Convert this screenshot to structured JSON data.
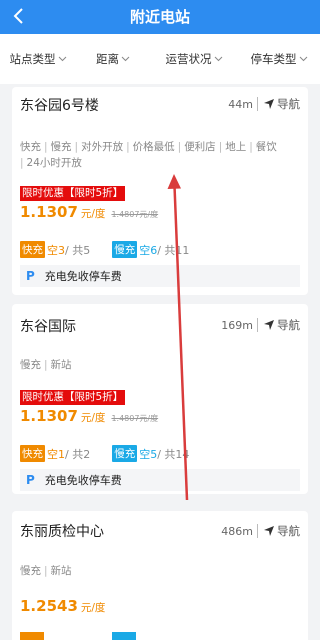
{
  "header": {
    "title": "附近电站"
  },
  "filters": [
    {
      "label": "站点类型"
    },
    {
      "label": "距离"
    },
    {
      "label": "运营状况"
    },
    {
      "label": "停车类型"
    }
  ],
  "stations": [
    {
      "name": "东谷园6号楼",
      "distance": "44m",
      "nav_label": "导航",
      "tags": [
        "快充",
        "慢充",
        "对外开放",
        "价格最低",
        "便利店",
        "地上",
        "餐饮",
        "24小时开放"
      ],
      "promo": "限时优惠【限时5折】",
      "price": "1.1307",
      "unit": "元/度",
      "original_price": "1.4807元/度",
      "fast": {
        "label": "快充",
        "free": "空3",
        "total": "/ 共5"
      },
      "slow": {
        "label": "慢充",
        "free": "空6",
        "total": "/ 共11"
      },
      "parking": {
        "icon": "P",
        "text": "充电免收停车费"
      }
    },
    {
      "name": "东谷国际",
      "distance": "169m",
      "nav_label": "导航",
      "tags": [
        "慢充",
        "新站"
      ],
      "promo": "限时优惠【限时5折】",
      "price": "1.1307",
      "unit": "元/度",
      "original_price": "1.4807元/度",
      "fast": {
        "label": "快充",
        "free": "空1",
        "total": "/ 共2"
      },
      "slow": {
        "label": "慢充",
        "free": "空5",
        "total": "/ 共14"
      },
      "parking": {
        "icon": "P",
        "text": "充电免收停车费"
      }
    },
    {
      "name": "东丽质检中心",
      "distance": "486m",
      "nav_label": "导航",
      "tags": [
        "慢充",
        "新站"
      ],
      "price": "1.2543",
      "unit": "元/度"
    }
  ],
  "colors": {
    "brand": "#2d8cf0",
    "fast": "#f08a00",
    "slow": "#1aa9e6",
    "promo": "#e40c0c"
  },
  "icons": {
    "back": "chevron-left-icon",
    "navigate": "navigation-arrow-icon",
    "filter": "chevron-down-icon",
    "annotation": "red-arrow-annotation"
  }
}
